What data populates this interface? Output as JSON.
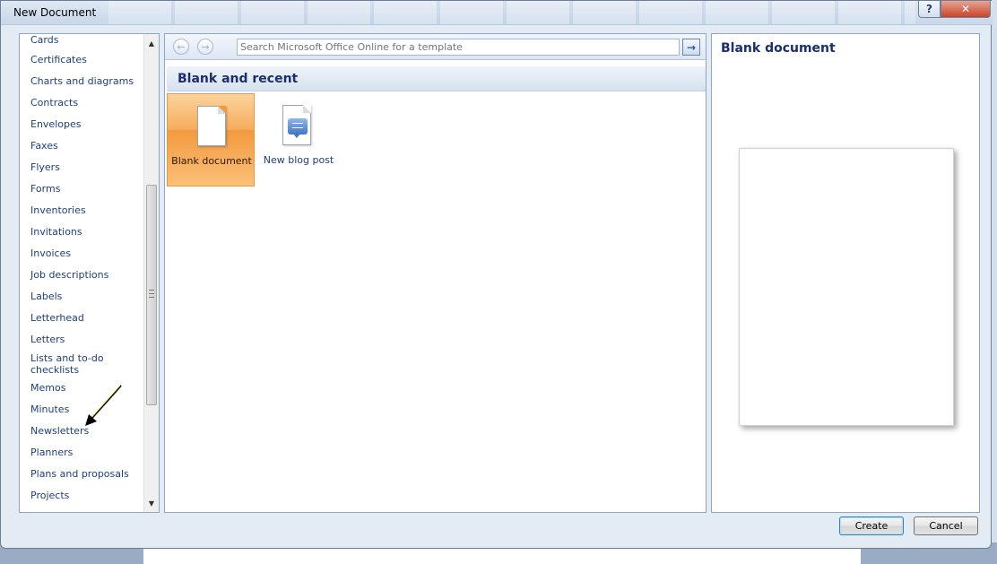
{
  "window": {
    "title": "New Document",
    "help_label": "?",
    "close_label": "✕"
  },
  "categories": [
    "Cards",
    "Certificates",
    "Charts and diagrams",
    "Contracts",
    "Envelopes",
    "Faxes",
    "Flyers",
    "Forms",
    "Inventories",
    "Invitations",
    "Invoices",
    "Job descriptions",
    "Labels",
    "Letterhead",
    "Letters",
    "Lists and to-do checklists",
    "Memos",
    "Minutes",
    "Newsletters",
    "Planners",
    "Plans and proposals",
    "Projects"
  ],
  "search": {
    "placeholder": "Search Microsoft Office Online for a template",
    "back_icon": "←",
    "forward_icon": "→",
    "go_icon": "→"
  },
  "section": {
    "title": "Blank and recent"
  },
  "templates": [
    {
      "label": "Blank document",
      "icon": "blank-document-icon",
      "selected": true
    },
    {
      "label": "New blog post",
      "icon": "blog-post-icon",
      "selected": false
    }
  ],
  "preview": {
    "title": "Blank document"
  },
  "buttons": {
    "create": "Create",
    "cancel": "Cancel"
  },
  "colors": {
    "accent_orange": "#f39a3f",
    "link_blue": "#1e3f7a",
    "annotation_arrow": "#000000"
  }
}
